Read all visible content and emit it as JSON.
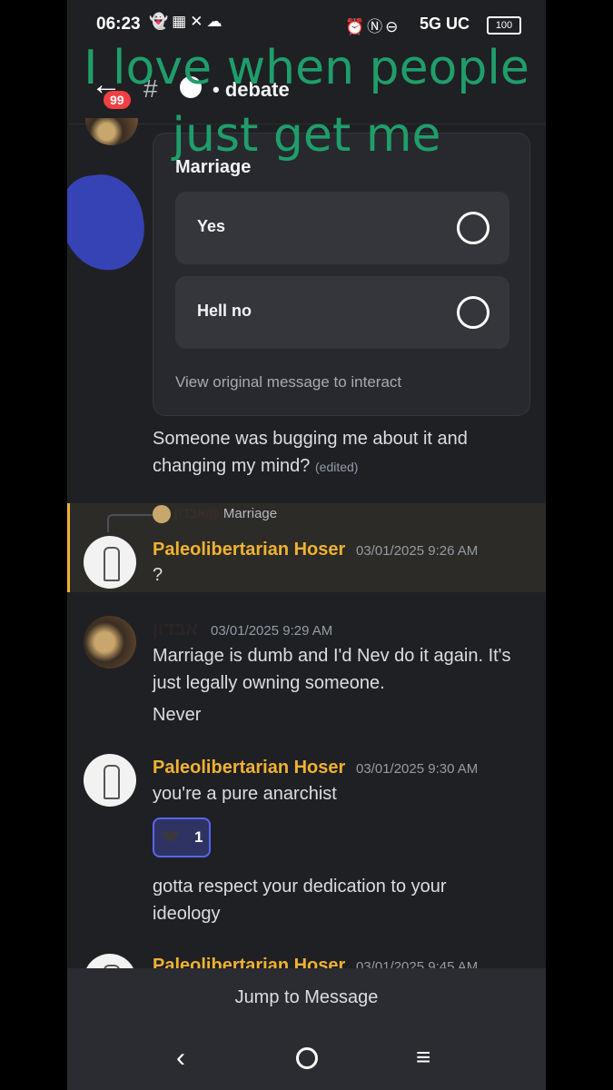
{
  "status": {
    "time": "06:23",
    "network": "5G UC",
    "battery": "100"
  },
  "header": {
    "badge": "99",
    "hash": "#",
    "channel": "• debate"
  },
  "overlay_caption": "I love when people just get me",
  "poll": {
    "question": "Marriage",
    "options": [
      "Yes",
      "Hell no"
    ],
    "view_link": "View original message to interact"
  },
  "messages": {
    "first_text": "Someone was bugging me about it and changing my mind?",
    "edited": "(edited)",
    "reply": {
      "name": "אבדון@",
      "preview": "Marriage"
    },
    "m1": {
      "user": "Paleolibertarian Hoser",
      "time": "03/01/2025 9:26 AM",
      "text": "?"
    },
    "m2": {
      "user": "אבדון",
      "time": "03/01/2025 9:29 AM",
      "text": "Marriage is dumb and I'd Nev do it again. It's just legally owning someone.",
      "text2": "Never"
    },
    "m3": {
      "user": "Paleolibertarian Hoser",
      "time": "03/01/2025 9:30 AM",
      "text": "you're a pure anarchist",
      "reaction_count": "1",
      "text2": "gotta respect your dedication to your ideology"
    },
    "m4": {
      "user": "Paleolibertarian Hoser",
      "time": "03/01/2025 9:45 AM"
    }
  },
  "jump_label": "Jump to Message",
  "colors": {
    "accent": "#5865f2",
    "username": "#f0b232",
    "overlay": "#1f9e6b"
  }
}
